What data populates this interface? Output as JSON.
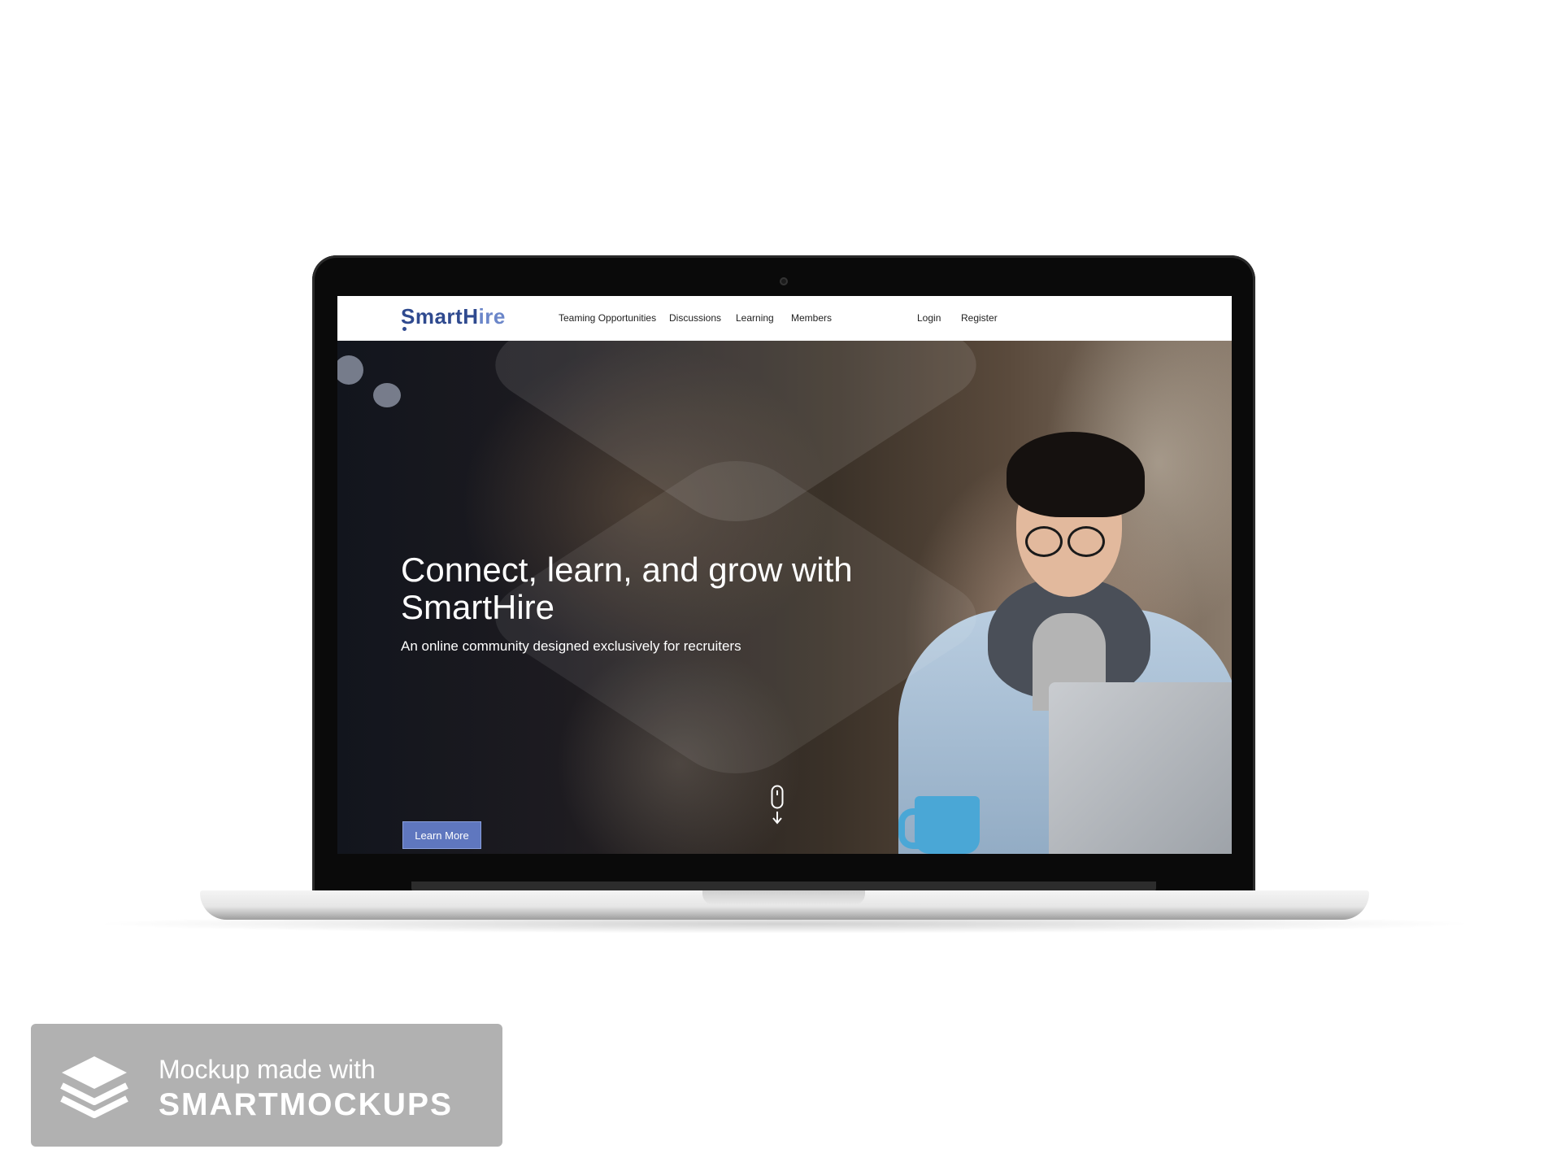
{
  "nav": {
    "logo_main": "SmartH",
    "logo_accent": "ire",
    "items": [
      "Teaming Opportunities",
      "Discussions",
      "Learning",
      "Members"
    ],
    "login_label": "Login",
    "register_label": "Register"
  },
  "hero": {
    "title": "Connect, learn, and grow with SmartHire",
    "subtitle": "An online community designed exclusively for recruiters",
    "cta_label": "Learn More"
  },
  "watermark": {
    "line1": "Mockup made with",
    "line2": "SMARTMOCKUPS"
  },
  "colors": {
    "brand": "#2f4a8f",
    "brand_accent": "#6b86c9",
    "button": "#5f77bf",
    "watermark_bg": "#b1b1b1"
  },
  "icons": [
    "mouse-scroll-icon",
    "layers-icon"
  ]
}
